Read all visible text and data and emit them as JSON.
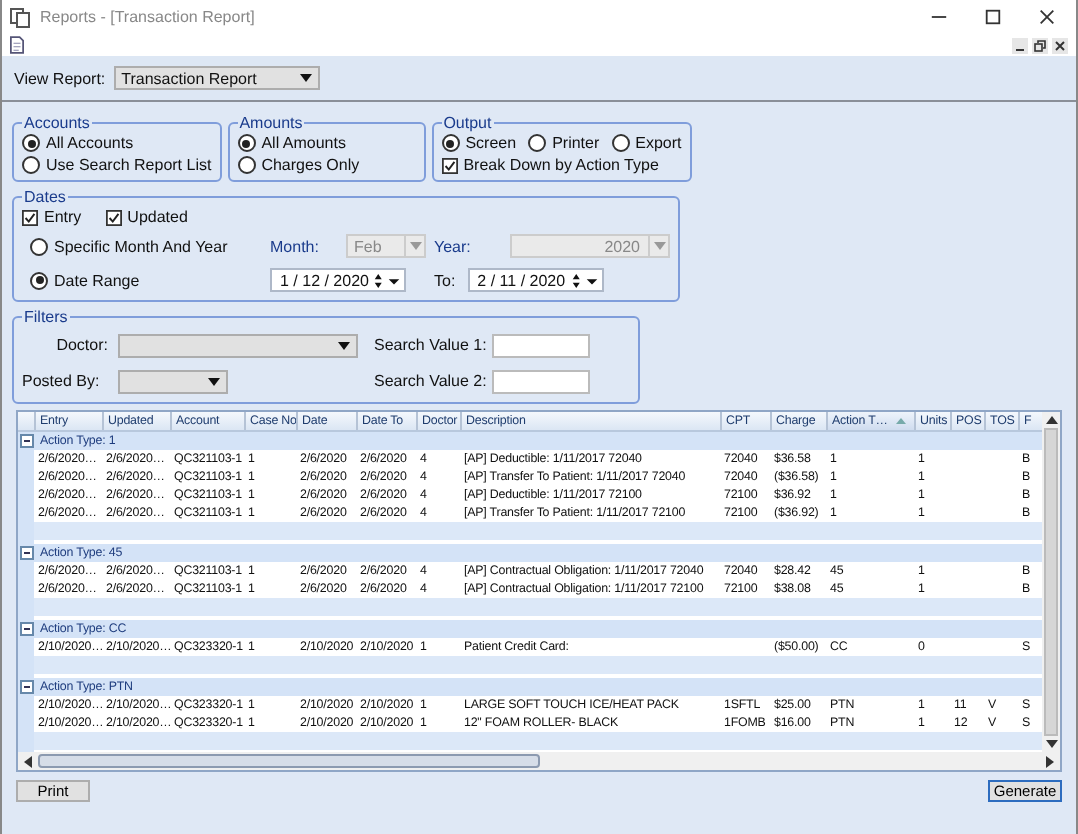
{
  "window": {
    "title": "Reports - [Transaction Report]"
  },
  "view_report": {
    "label": "View Report:",
    "value": "Transaction Report"
  },
  "accounts": {
    "title": "Accounts",
    "options": [
      {
        "label": "All Accounts",
        "selected": true
      },
      {
        "label": "Use Search Report List",
        "selected": false
      }
    ]
  },
  "amounts": {
    "title": "Amounts",
    "options": [
      {
        "label": "All Amounts",
        "selected": true
      },
      {
        "label": "Charges Only",
        "selected": false
      }
    ]
  },
  "output": {
    "title": "Output",
    "options": [
      {
        "label": "Screen",
        "selected": true
      },
      {
        "label": "Printer",
        "selected": false
      },
      {
        "label": "Export",
        "selected": false
      }
    ],
    "break_down": {
      "label": "Break Down by Action Type",
      "checked": true
    }
  },
  "dates": {
    "title": "Dates",
    "checks": [
      {
        "label": "Entry",
        "checked": true
      },
      {
        "label": "Updated",
        "checked": true
      }
    ],
    "modes": [
      {
        "label": "Specific Month And Year",
        "selected": false
      },
      {
        "label": "Date Range",
        "selected": true
      }
    ],
    "month": {
      "label": "Month:",
      "value": "Feb",
      "disabled": true
    },
    "year": {
      "label": "Year:",
      "value": "2020",
      "disabled": true
    },
    "from": "1 / 12 / 2020",
    "to_label": "To:",
    "to": "2 / 11 / 2020"
  },
  "filters": {
    "title": "Filters",
    "doctor": {
      "label": "Doctor:"
    },
    "posted_by": {
      "label": "Posted By:"
    },
    "search_1": {
      "label": "Search Value 1:"
    },
    "search_2": {
      "label": "Search Value 2:"
    }
  },
  "table": {
    "columns": [
      {
        "label": "Entry",
        "sorted": false
      },
      {
        "label": "Updated",
        "sorted": false
      },
      {
        "label": "Account",
        "sorted": false
      },
      {
        "label": "Case No",
        "sorted": false
      },
      {
        "label": "Date",
        "sorted": false
      },
      {
        "label": "Date To",
        "sorted": false
      },
      {
        "label": "Doctor",
        "sorted": false
      },
      {
        "label": "Description",
        "sorted": false
      },
      {
        "label": "CPT",
        "sorted": false
      },
      {
        "label": "Charge",
        "sorted": false
      },
      {
        "label": "Action T…",
        "sorted": true
      },
      {
        "label": "Units",
        "sorted": false
      },
      {
        "label": "POS",
        "sorted": false
      },
      {
        "label": "TOS",
        "sorted": false
      },
      {
        "label": "F",
        "sorted": false
      }
    ],
    "groups": [
      {
        "label": "Action Type: 1",
        "expanded": true,
        "rows": [
          [
            "2/6/2020…",
            "2/6/2020…",
            "QC321103-1",
            "1",
            "2/6/2020",
            "2/6/2020",
            "4",
            "[AP] Deductible: 1/11/2017 72040",
            "72040",
            "$36.58",
            "1",
            "1",
            null,
            null,
            "B"
          ],
          [
            "2/6/2020…",
            "2/6/2020…",
            "QC321103-1",
            "1",
            "2/6/2020",
            "2/6/2020",
            "4",
            "[AP] Transfer To Patient: 1/11/2017 72040",
            "72040",
            "($36.58)",
            "1",
            "1",
            null,
            null,
            "B"
          ],
          [
            "2/6/2020…",
            "2/6/2020…",
            "QC321103-1",
            "1",
            "2/6/2020",
            "2/6/2020",
            "4",
            "[AP] Deductible: 1/11/2017 72100",
            "72100",
            "$36.92",
            "1",
            "1",
            null,
            null,
            "B"
          ],
          [
            "2/6/2020…",
            "2/6/2020…",
            "QC321103-1",
            "1",
            "2/6/2020",
            "2/6/2020",
            "4",
            "[AP] Transfer To Patient: 1/11/2017 72100",
            "72100",
            "($36.92)",
            "1",
            "1",
            null,
            null,
            "B"
          ]
        ]
      },
      {
        "label": "Action Type: 45",
        "expanded": true,
        "rows": [
          [
            "2/6/2020…",
            "2/6/2020…",
            "QC321103-1",
            "1",
            "2/6/2020",
            "2/6/2020",
            "4",
            "[AP] Contractual Obligation: 1/11/2017 72040",
            "72040",
            "$28.42",
            "45",
            "1",
            null,
            null,
            "B"
          ],
          [
            "2/6/2020…",
            "2/6/2020…",
            "QC321103-1",
            "1",
            "2/6/2020",
            "2/6/2020",
            "4",
            "[AP] Contractual Obligation: 1/11/2017 72100",
            "72100",
            "$38.08",
            "45",
            "1",
            null,
            null,
            "B"
          ]
        ]
      },
      {
        "label": "Action Type: CC",
        "expanded": true,
        "rows": [
          [
            "2/10/2020…",
            "2/10/2020…",
            "QC323320-1",
            "1",
            "2/10/2020",
            "2/10/2020",
            "1",
            "Patient Credit Card:",
            null,
            "($50.00)",
            "CC",
            "0",
            null,
            null,
            "S"
          ]
        ]
      },
      {
        "label": "Action Type: PTN",
        "expanded": true,
        "rows": [
          [
            "2/10/2020…",
            "2/10/2020…",
            "QC323320-1",
            "1",
            "2/10/2020",
            "2/10/2020",
            "1",
            "LARGE SOFT TOUCH ICE/HEAT PACK",
            "1SFTL",
            "$25.00",
            "PTN",
            "1",
            "11",
            "V",
            "S"
          ],
          [
            "2/10/2020…",
            "2/10/2020…",
            "QC323320-1",
            "1",
            "2/10/2020",
            "2/10/2020",
            "1",
            "12\" FOAM ROLLER- BLACK",
            "1FOMB",
            "$16.00",
            "PTN",
            "1",
            "12",
            "V",
            "S"
          ]
        ]
      }
    ]
  },
  "buttons": {
    "print": "Print",
    "generate": "Generate"
  }
}
